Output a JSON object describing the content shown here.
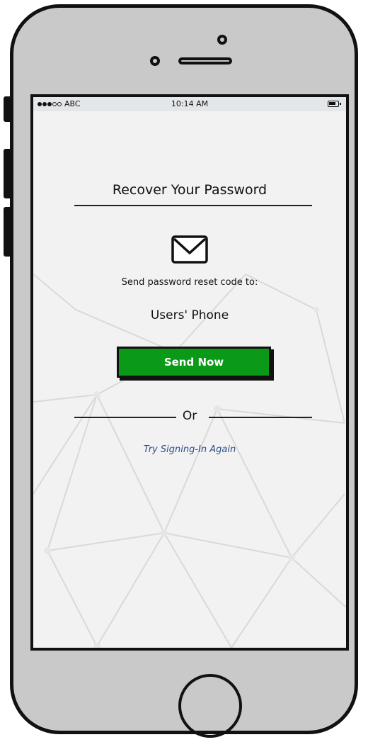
{
  "status_bar": {
    "carrier": "ABC",
    "time": "10:14 AM"
  },
  "screen": {
    "title": "Recover Your Password",
    "prompt": "Send password reset code to:",
    "target": "Users' Phone",
    "send_button_label": "Send Now",
    "divider_label": "Or",
    "retry_link": "Try Signing-In Again"
  },
  "colors": {
    "send_button": "#0a9a17",
    "link": "#2a4e8a",
    "status_bar": "#e3e7ea"
  },
  "icons": {
    "mail": "envelope-icon",
    "battery": "battery-icon",
    "signal": "signal-icon"
  }
}
